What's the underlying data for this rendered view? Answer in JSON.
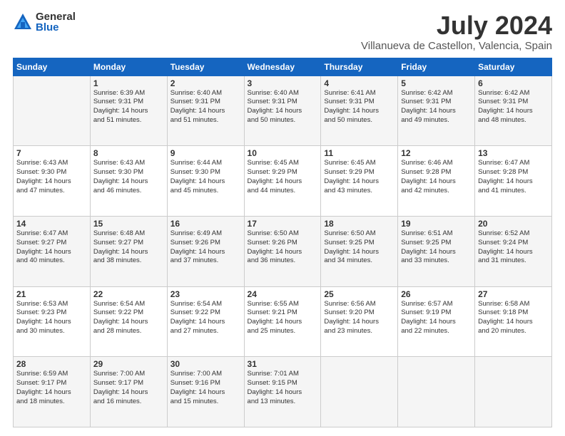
{
  "logo": {
    "general": "General",
    "blue": "Blue"
  },
  "title": {
    "month": "July 2024",
    "location": "Villanueva de Castellon, Valencia, Spain"
  },
  "headers": [
    "Sunday",
    "Monday",
    "Tuesday",
    "Wednesday",
    "Thursday",
    "Friday",
    "Saturday"
  ],
  "weeks": [
    [
      {
        "day": "",
        "info": ""
      },
      {
        "day": "1",
        "info": "Sunrise: 6:39 AM\nSunset: 9:31 PM\nDaylight: 14 hours\nand 51 minutes."
      },
      {
        "day": "2",
        "info": "Sunrise: 6:40 AM\nSunset: 9:31 PM\nDaylight: 14 hours\nand 51 minutes."
      },
      {
        "day": "3",
        "info": "Sunrise: 6:40 AM\nSunset: 9:31 PM\nDaylight: 14 hours\nand 50 minutes."
      },
      {
        "day": "4",
        "info": "Sunrise: 6:41 AM\nSunset: 9:31 PM\nDaylight: 14 hours\nand 50 minutes."
      },
      {
        "day": "5",
        "info": "Sunrise: 6:42 AM\nSunset: 9:31 PM\nDaylight: 14 hours\nand 49 minutes."
      },
      {
        "day": "6",
        "info": "Sunrise: 6:42 AM\nSunset: 9:31 PM\nDaylight: 14 hours\nand 48 minutes."
      }
    ],
    [
      {
        "day": "7",
        "info": "Sunrise: 6:43 AM\nSunset: 9:30 PM\nDaylight: 14 hours\nand 47 minutes."
      },
      {
        "day": "8",
        "info": "Sunrise: 6:43 AM\nSunset: 9:30 PM\nDaylight: 14 hours\nand 46 minutes."
      },
      {
        "day": "9",
        "info": "Sunrise: 6:44 AM\nSunset: 9:30 PM\nDaylight: 14 hours\nand 45 minutes."
      },
      {
        "day": "10",
        "info": "Sunrise: 6:45 AM\nSunset: 9:29 PM\nDaylight: 14 hours\nand 44 minutes."
      },
      {
        "day": "11",
        "info": "Sunrise: 6:45 AM\nSunset: 9:29 PM\nDaylight: 14 hours\nand 43 minutes."
      },
      {
        "day": "12",
        "info": "Sunrise: 6:46 AM\nSunset: 9:28 PM\nDaylight: 14 hours\nand 42 minutes."
      },
      {
        "day": "13",
        "info": "Sunrise: 6:47 AM\nSunset: 9:28 PM\nDaylight: 14 hours\nand 41 minutes."
      }
    ],
    [
      {
        "day": "14",
        "info": "Sunrise: 6:47 AM\nSunset: 9:27 PM\nDaylight: 14 hours\nand 40 minutes."
      },
      {
        "day": "15",
        "info": "Sunrise: 6:48 AM\nSunset: 9:27 PM\nDaylight: 14 hours\nand 38 minutes."
      },
      {
        "day": "16",
        "info": "Sunrise: 6:49 AM\nSunset: 9:26 PM\nDaylight: 14 hours\nand 37 minutes."
      },
      {
        "day": "17",
        "info": "Sunrise: 6:50 AM\nSunset: 9:26 PM\nDaylight: 14 hours\nand 36 minutes."
      },
      {
        "day": "18",
        "info": "Sunrise: 6:50 AM\nSunset: 9:25 PM\nDaylight: 14 hours\nand 34 minutes."
      },
      {
        "day": "19",
        "info": "Sunrise: 6:51 AM\nSunset: 9:25 PM\nDaylight: 14 hours\nand 33 minutes."
      },
      {
        "day": "20",
        "info": "Sunrise: 6:52 AM\nSunset: 9:24 PM\nDaylight: 14 hours\nand 31 minutes."
      }
    ],
    [
      {
        "day": "21",
        "info": "Sunrise: 6:53 AM\nSunset: 9:23 PM\nDaylight: 14 hours\nand 30 minutes."
      },
      {
        "day": "22",
        "info": "Sunrise: 6:54 AM\nSunset: 9:22 PM\nDaylight: 14 hours\nand 28 minutes."
      },
      {
        "day": "23",
        "info": "Sunrise: 6:54 AM\nSunset: 9:22 PM\nDaylight: 14 hours\nand 27 minutes."
      },
      {
        "day": "24",
        "info": "Sunrise: 6:55 AM\nSunset: 9:21 PM\nDaylight: 14 hours\nand 25 minutes."
      },
      {
        "day": "25",
        "info": "Sunrise: 6:56 AM\nSunset: 9:20 PM\nDaylight: 14 hours\nand 23 minutes."
      },
      {
        "day": "26",
        "info": "Sunrise: 6:57 AM\nSunset: 9:19 PM\nDaylight: 14 hours\nand 22 minutes."
      },
      {
        "day": "27",
        "info": "Sunrise: 6:58 AM\nSunset: 9:18 PM\nDaylight: 14 hours\nand 20 minutes."
      }
    ],
    [
      {
        "day": "28",
        "info": "Sunrise: 6:59 AM\nSunset: 9:17 PM\nDaylight: 14 hours\nand 18 minutes."
      },
      {
        "day": "29",
        "info": "Sunrise: 7:00 AM\nSunset: 9:17 PM\nDaylight: 14 hours\nand 16 minutes."
      },
      {
        "day": "30",
        "info": "Sunrise: 7:00 AM\nSunset: 9:16 PM\nDaylight: 14 hours\nand 15 minutes."
      },
      {
        "day": "31",
        "info": "Sunrise: 7:01 AM\nSunset: 9:15 PM\nDaylight: 14 hours\nand 13 minutes."
      },
      {
        "day": "",
        "info": ""
      },
      {
        "day": "",
        "info": ""
      },
      {
        "day": "",
        "info": ""
      }
    ]
  ]
}
